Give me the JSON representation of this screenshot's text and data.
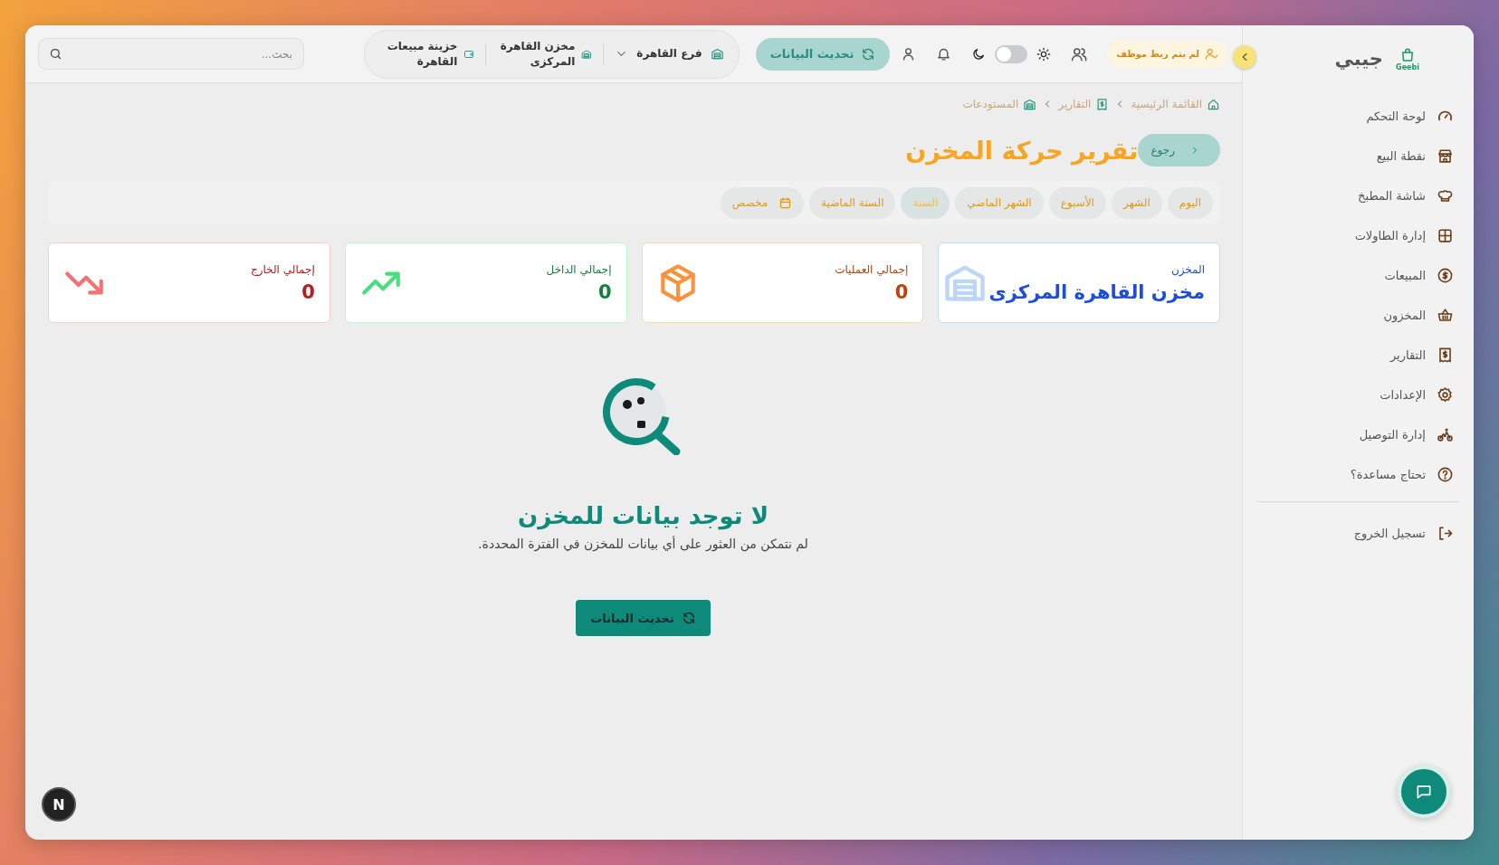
{
  "sidebar": {
    "logo_text": "Geebi",
    "brand": "جيبي",
    "items": [
      {
        "label": "لوحة التحكم"
      },
      {
        "label": "نقطة البيع"
      },
      {
        "label": "شاشة المطبخ"
      },
      {
        "label": "إدارة الطاولات"
      },
      {
        "label": "المبيعات"
      },
      {
        "label": "المخزون"
      },
      {
        "label": "التقارير"
      },
      {
        "label": "الإعدادات"
      },
      {
        "label": "إدارة التوصيل"
      },
      {
        "label": "تحتاج مساعدة؟"
      }
    ],
    "logout": "تسجيل الخروج"
  },
  "header": {
    "employee_badge": "لم يتم ربط موظف",
    "dark_mode": false,
    "refresh_button": "تحديث البيانات",
    "branch": "فرع القاهرة",
    "warehouse": "مخزن القاهرة المركزى",
    "treasury": "خزينة مبيعات القاهرة",
    "search": {
      "placeholder": "بحث..."
    }
  },
  "breadcrumbs": [
    "القائمة الرئيسية",
    "التقارير",
    "المستودعات"
  ],
  "title": "تقرير حركة المخزن",
  "back_button": "رجوع",
  "periods": [
    {
      "label": "اليوم",
      "selected": false
    },
    {
      "label": "الشهر",
      "selected": false
    },
    {
      "label": "الأسبوع",
      "selected": false
    },
    {
      "label": "الشهر الماضي",
      "selected": false
    },
    {
      "label": "السنة",
      "selected": true
    },
    {
      "label": "السنة الماضية",
      "selected": false
    },
    {
      "label": "مخصص",
      "selected": false,
      "kind": "custom"
    }
  ],
  "stats": [
    {
      "kind": "warehouse",
      "label": "المخزن",
      "value": "مخزن القاهرة المركزى",
      "color": "#1d4ed8"
    },
    {
      "kind": "operations",
      "label": "إجمالي العمليات",
      "value": "0",
      "color": "#c2410c"
    },
    {
      "kind": "in",
      "label": "إجمالي الداخل",
      "value": "0",
      "color": "#15803d"
    },
    {
      "kind": "out",
      "label": "إجمالي الخارج",
      "value": "0",
      "color": "#b91c1c"
    }
  ],
  "empty_state": {
    "title": "لا توجد بيانات للمخزن",
    "message": "لم نتمكن من العثور على أي بيانات للمخزن في الفترة المحددة.",
    "button": "تحديث البيانات"
  },
  "dev_badge": "N"
}
